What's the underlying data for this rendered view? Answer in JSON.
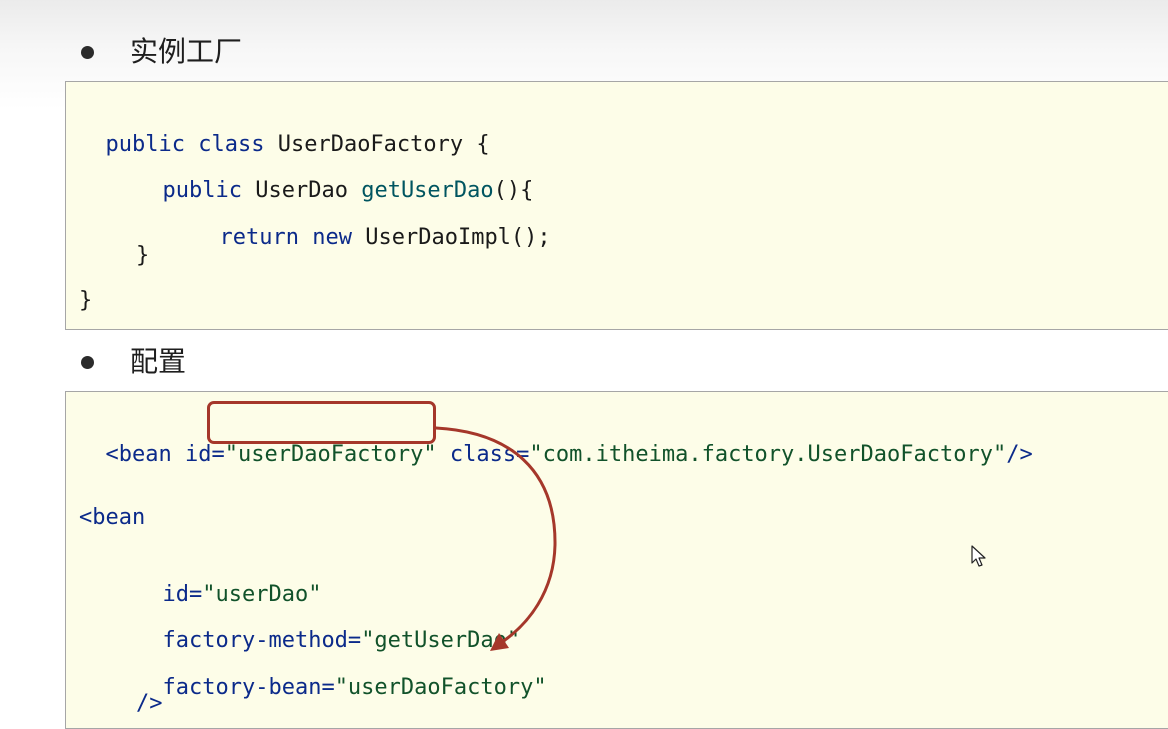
{
  "section1": {
    "label": "实例工厂",
    "code": {
      "line1": {
        "kw1": "public",
        "kw2": "class",
        "name": "UserDaoFactory",
        "brace": "{"
      },
      "line2": {
        "kw": "public",
        "type": "UserDao",
        "method": "getUserDao",
        "rest": "(){"
      },
      "line3": {
        "kw1": "return",
        "kw2": "new",
        "rest": "UserDaoImpl();"
      },
      "line4": {
        "text": "}"
      },
      "line5": {
        "text": "}"
      }
    }
  },
  "section2": {
    "label": "配置",
    "code": {
      "line1": {
        "tag": "<bean",
        "id_attr": "id=",
        "id_value": "\"userDaoFactory\"",
        "class_attr": "class=",
        "class_value": "\"com.itheima.factory.UserDaoFactory\"",
        "end": "/>"
      },
      "line2": {
        "tag": "<bean"
      },
      "line3": {
        "attr": "id=",
        "value": "\"userDao\""
      },
      "line4": {
        "attr": "factory-method=",
        "value": "\"getUserDao\""
      },
      "line5": {
        "attr": "factory-bean=",
        "value": "\"userDaoFactory\""
      },
      "line6": {
        "text": "/>"
      }
    }
  },
  "colors": {
    "keyword": "#0b2a8a",
    "string": "#11522a",
    "method": "#005560",
    "annotation": "#a5372a",
    "code_background": "#fdfde8"
  },
  "icons": {
    "cursor": "mouse-pointer-icon",
    "arrow": "curved-arrow-icon"
  }
}
